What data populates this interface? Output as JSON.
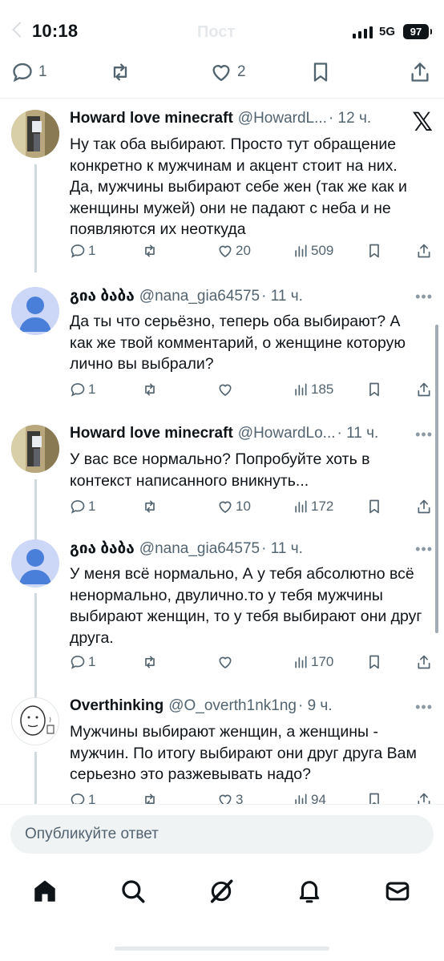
{
  "status_bar": {
    "time": "10:18",
    "network": "5G",
    "battery": "97",
    "title_behind": "Пост"
  },
  "post_actions": {
    "replies": "1",
    "retweets": "",
    "likes": "2"
  },
  "replies": [
    {
      "author": "Howard love minecraft",
      "handle": "@HowardL...",
      "time": "· 12 ч.",
      "text": "Ну так оба выбирают. Просто тут обращение конкретно к мужчинам и акцент стоит на них. Да, мужчины выбирают себе жен (так же как и женщины мужей) они не падают с неба и не появляются их неоткуда",
      "replies": "1",
      "reposts": "",
      "likes": "20",
      "views": "509"
    },
    {
      "author": "გია ბაბა",
      "handle": "@nana_gia64575",
      "time": "· 11 ч.",
      "text": "Да ты что серьёзно, теперь оба выбирают? А как же твой комментарий, о женщине которую лично вы выбрали?",
      "replies": "1",
      "reposts": "",
      "likes": "",
      "views": "185"
    },
    {
      "author": "Howard love minecraft",
      "handle": "@HowardLo...",
      "time": "· 11 ч.",
      "text": "У вас все нормально? Попробуйте хоть в контекст написанного вникнуть...",
      "replies": "1",
      "reposts": "",
      "likes": "10",
      "views": "172"
    },
    {
      "author": "გია ბაბა",
      "handle": "@nana_gia64575",
      "time": "· 11 ч.",
      "text": "У меня всё нормально, А у тебя абсолютно всё ненормально, двулично.то у тебя мужчины выбирают женщин, то у тебя выбирают они друг друга.",
      "replies": "1",
      "reposts": "",
      "likes": "",
      "views": "170"
    },
    {
      "author": "Overthinking",
      "handle": "@O_overth1nk1ng",
      "time": "· 9 ч.",
      "text": "Мужчины выбирают женщин, а женщины - мужчин. По итогу выбирают они друг друга Вам серьезно это разжевывать надо?",
      "replies": "1",
      "reposts": "",
      "likes": "3",
      "views": "94"
    }
  ],
  "composer": {
    "placeholder": "Опубликуйте ответ"
  },
  "nav": [
    "home-icon",
    "search-icon",
    "grok-icon",
    "notifications-icon",
    "messages-icon"
  ]
}
